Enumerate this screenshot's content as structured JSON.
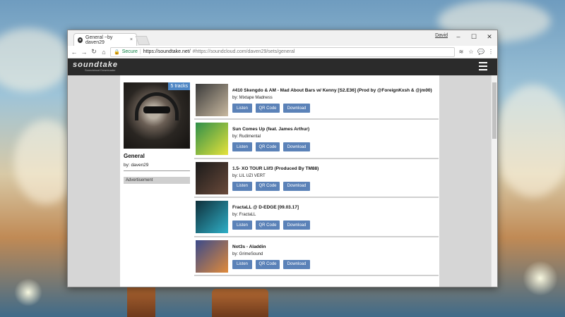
{
  "browser": {
    "tab_title": "General ~by daven29",
    "tab_favicon": "soundcloud-favicon",
    "user_name": "David",
    "window_controls": [
      "–",
      "☐",
      "✕"
    ],
    "secure_label": "Secure",
    "url_host": "https://soundtake.net/",
    "url_path": "#https://soundcloud.com/daven29/sets/general"
  },
  "site": {
    "logo": "soundtake",
    "logo_sub": "Soundcloud Downloader"
  },
  "playlist": {
    "badge": "5 tracks",
    "title": "General",
    "by": "by: daven29",
    "ad_label": "Advertisement"
  },
  "buttons": {
    "listen": "Listen",
    "qr": "QR Code",
    "download": "Download"
  },
  "tracks": [
    {
      "title": "#410 Skengdo & AM - Mad About Bars w/ Kenny [S2.E36] (Prod by @ForeignKxsh & @jm00)",
      "artist": "by: Mixtape Madness",
      "art_colors": [
        "#3a3a3a",
        "#c9b9a0"
      ]
    },
    {
      "title": "Sun Comes Up (feat. James Arthur)",
      "artist": "by: Rudimental",
      "art_colors": [
        "#2f8f4a",
        "#e6e23a"
      ]
    },
    {
      "title": "1.5- XO TOUR Llif3 (Produced By TM88)",
      "artist": "by: LIL UZI VERT",
      "art_colors": [
        "#1a1a1a",
        "#6a4a3a"
      ]
    },
    {
      "title": "FractaLL @ D-EDGE [09.03.17]",
      "artist": "by: FractaLL",
      "art_colors": [
        "#0f2f3a",
        "#2fb0c8"
      ]
    },
    {
      "title": "Not3s - Aladdin",
      "artist": "by: GrimeSound",
      "art_colors": [
        "#3b4a8a",
        "#e08a3a"
      ]
    }
  ],
  "colors": {
    "button": "#5b82b8",
    "header": "#2b2b2b",
    "badge": "#4e86c4"
  }
}
